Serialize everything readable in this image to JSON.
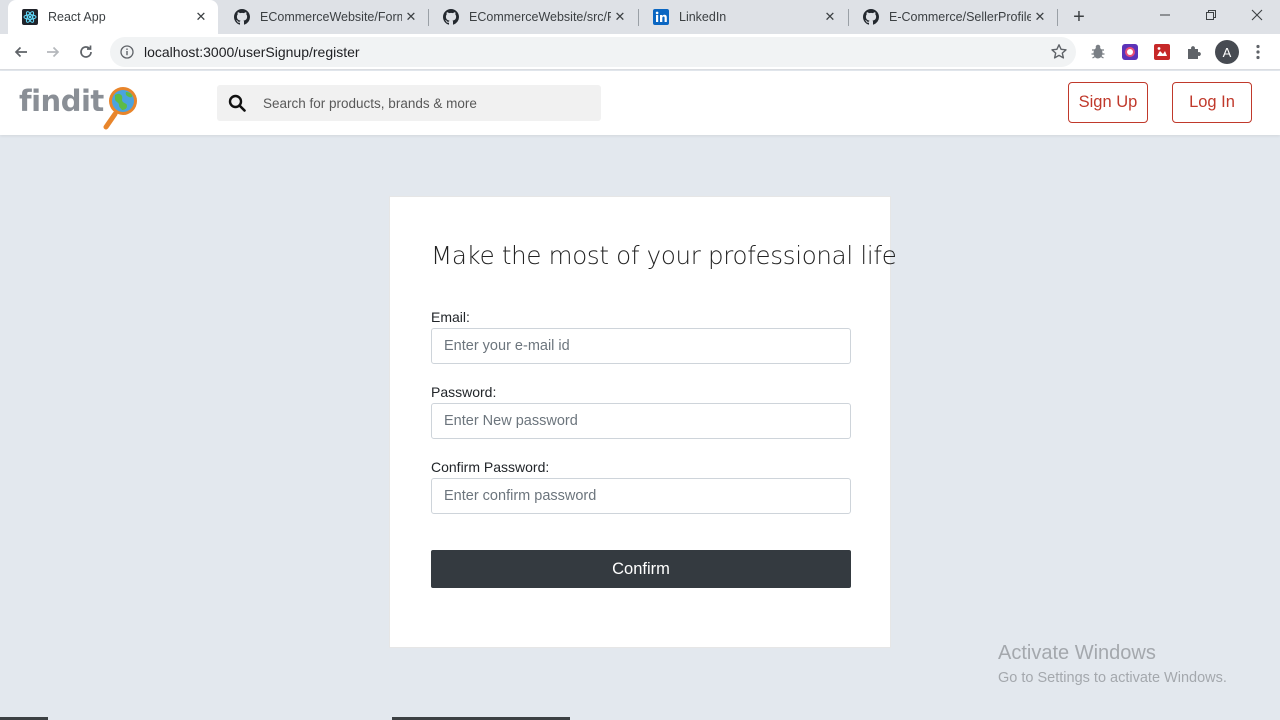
{
  "browser": {
    "tabs": [
      {
        "title": "React App",
        "icon": "react-icon",
        "active": true
      },
      {
        "title": "ECommerceWebsite/Form.js",
        "icon": "github-icon",
        "active": false
      },
      {
        "title": "ECommerceWebsite/src/Ro",
        "icon": "github-icon",
        "active": false
      },
      {
        "title": "LinkedIn",
        "icon": "linkedin-icon",
        "active": false
      },
      {
        "title": "E-Commerce/SellerProfile.js",
        "icon": "github-icon",
        "active": false
      }
    ],
    "new_tab_label": "+",
    "url": "localhost:3000/userSignup/register",
    "profile_initial": "A"
  },
  "header": {
    "logo_text": "findit",
    "search_placeholder": "Search for products, brands & more",
    "signup_label": "Sign Up",
    "login_label": "Log In",
    "accent_color": "#c0392b"
  },
  "form": {
    "title": "Make the most of your professional life",
    "email_label": "Email:",
    "email_placeholder": "Enter your e-mail id",
    "password_label": "Password:",
    "password_placeholder": "Enter New password",
    "confirm_label": "Confirm Password:",
    "confirm_placeholder": "Enter confirm password",
    "submit_label": "Confirm"
  },
  "watermark": {
    "line1": "Activate Windows",
    "line2": "Go to Settings to activate Windows."
  }
}
